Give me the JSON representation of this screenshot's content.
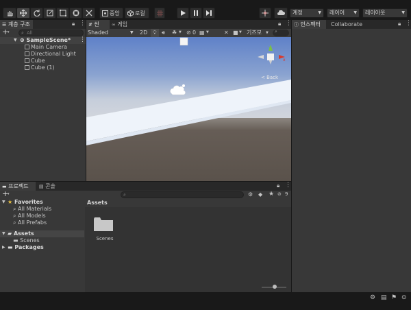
{
  "toolbar": {
    "tools": [
      "hand-tool",
      "move-tool",
      "rotate-tool",
      "scale-tool",
      "rect-tool",
      "transform-tool",
      "custom-tool"
    ],
    "pivot_label": "중앙",
    "local_label": "로컬",
    "account_label": "계정",
    "layers_label": "레이어",
    "layout_label": "레이아웃"
  },
  "hierarchy": {
    "tab_label": "계층 구조",
    "search_placeholder": "All",
    "scene_name": "SampleScene*",
    "items": [
      "Main Camera",
      "Directional Light",
      "Cube",
      "Cube (1)"
    ]
  },
  "scene_view": {
    "tab_scene": "씬",
    "tab_game": "게임",
    "shading_mode": "Shaded",
    "mode_2d": "2D",
    "hidden_count": "0",
    "gizmos_label": "기즈모",
    "gizmo_back_label": "< Back",
    "gizmo_axis_y": "y",
    "gizmo_axis_x": "x"
  },
  "inspector": {
    "tab_label": "인스펙터",
    "tab_collab": "Collaborate"
  },
  "project": {
    "tab_label": "프로젝트",
    "tab_console": "콘솔",
    "hidden_count": "9",
    "favorites_label": "Favorites",
    "favorites": [
      "All Materials",
      "All Models",
      "All Prefabs"
    ],
    "assets_label": "Assets",
    "asset_children": [
      "Scenes"
    ],
    "packages_label": "Packages",
    "breadcrumb": "Assets",
    "grid_items": [
      {
        "name": "Scenes",
        "icon": "folder-icon"
      }
    ]
  },
  "colors": {
    "sky_top": "#5f81c8",
    "sky_horizon": "#c6cedb",
    "ground": "#5f5750",
    "plane": "#eef3fa",
    "accent": "#3a72b0"
  }
}
